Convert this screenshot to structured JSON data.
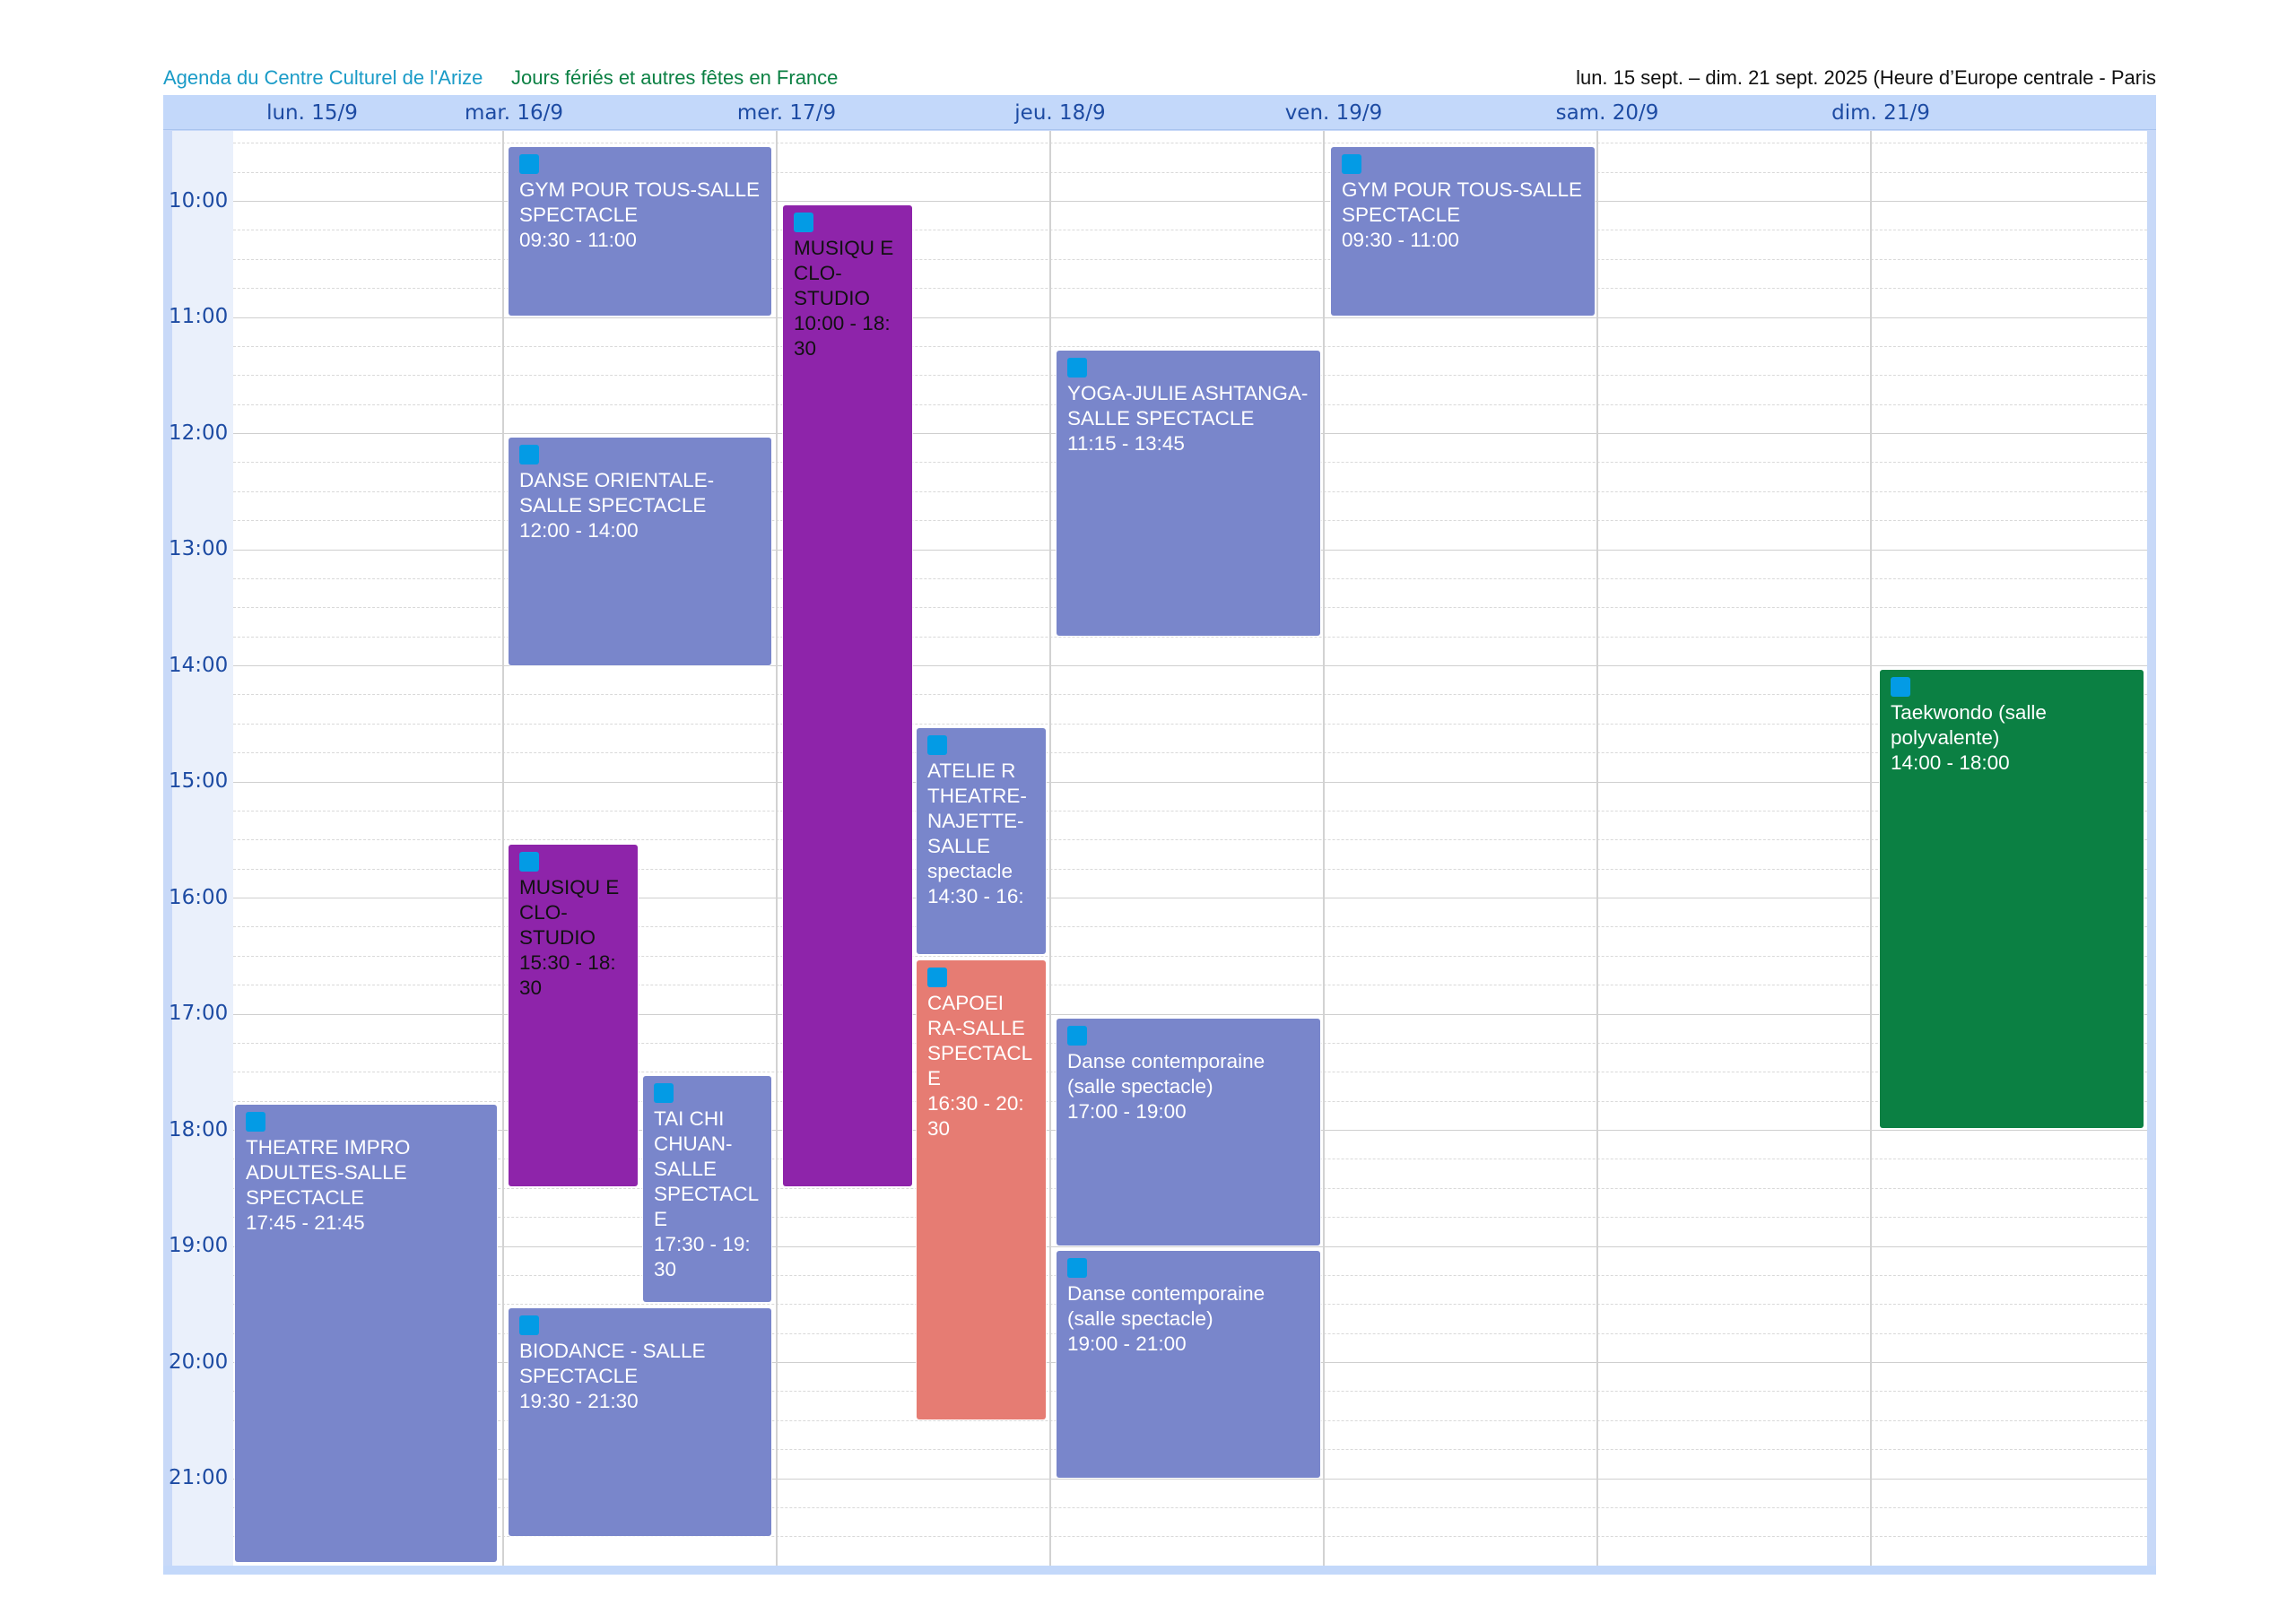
{
  "header": {
    "calendar_1": "Agenda du Centre Culturel de l'Arize",
    "calendar_2": "Jours fériés et autres fêtes en France",
    "date_range": "lun. 15 sept. – dim. 21 sept. 2025 (Heure d’Europe centrale - Paris"
  },
  "days": [
    {
      "label": "lun. 15/9"
    },
    {
      "label": "mar. 16/9"
    },
    {
      "label": "mer. 17/9"
    },
    {
      "label": "jeu. 18/9"
    },
    {
      "label": "ven. 19/9"
    },
    {
      "label": "sam. 20/9"
    },
    {
      "label": "dim. 21/9"
    }
  ],
  "hours": [
    "10:00",
    "11:00",
    "12:00",
    "13:00",
    "14:00",
    "15:00",
    "16:00",
    "17:00",
    "18:00",
    "19:00",
    "20:00",
    "21:00"
  ],
  "colors": {
    "event_blue": "#7986cb",
    "event_purple": "#8e24aa",
    "event_salmon": "#e67c73",
    "event_green": "#0b8043",
    "event_dot": "#039be5",
    "header_bg": "#c3d8fa",
    "header_text": "#1d4ba3"
  },
  "events": [
    {
      "day": "lun. 15/9",
      "title": "THEATRE IMPRO ADULTES-SALLE SPECTACLE",
      "time": "17:45 - 21:45",
      "color": "blue"
    },
    {
      "day": "mar. 16/9",
      "title": "GYM POUR TOUS-SALLE SPECTACLE",
      "time": "09:30 - 11:00",
      "color": "blue"
    },
    {
      "day": "mar. 16/9",
      "title": "DANSE ORIENTALE-SALLE SPECTACLE",
      "time": "12:00 - 14:00",
      "color": "blue"
    },
    {
      "day": "mar. 16/9",
      "title": "MUSIQU E CLO-STUDIO",
      "time": "15:30 - 18: 30",
      "color": "purple"
    },
    {
      "day": "mar. 16/9",
      "title": "TAI CHI CHUAN-SALLE SPECTACL E",
      "time": "17:30 - 19: 30",
      "color": "blue"
    },
    {
      "day": "mar. 16/9",
      "title": "BIODANCE - SALLE SPECTACLE",
      "time": "19:30 - 21:30",
      "color": "blue"
    },
    {
      "day": "mer. 17/9",
      "title": "MUSIQU E CLO-STUDIO",
      "time": "10:00 - 18: 30",
      "color": "purple"
    },
    {
      "day": "mer. 17/9",
      "title": "ATELIE R THEATRE-NAJETTE-SALLE spectacle",
      "time": "14:30 - 16:",
      "color": "blue"
    },
    {
      "day": "mer. 17/9",
      "title": "CAPOEI RA-SALLE SPECTACL E",
      "time": "16:30 - 20: 30",
      "color": "salmon"
    },
    {
      "day": "jeu. 18/9",
      "title": "YOGA-JULIE ASHTANGA-SALLE SPECTACLE",
      "time": "11:15 - 13:45",
      "color": "blue"
    },
    {
      "day": "jeu. 18/9",
      "title": "Danse contemporaine (salle spectacle)",
      "time": "17:00 - 19:00",
      "color": "blue"
    },
    {
      "day": "jeu. 18/9",
      "title": "Danse contemporaine (salle spectacle)",
      "time": "19:00 - 21:00",
      "color": "blue"
    },
    {
      "day": "ven. 19/9",
      "title": "GYM POUR TOUS-SALLE SPECTACLE",
      "time": "09:30 - 11:00",
      "color": "blue"
    },
    {
      "day": "dim. 21/9",
      "title": "Taekwondo (salle polyvalente)",
      "time": "14:00 - 18:00",
      "color": "green"
    }
  ]
}
